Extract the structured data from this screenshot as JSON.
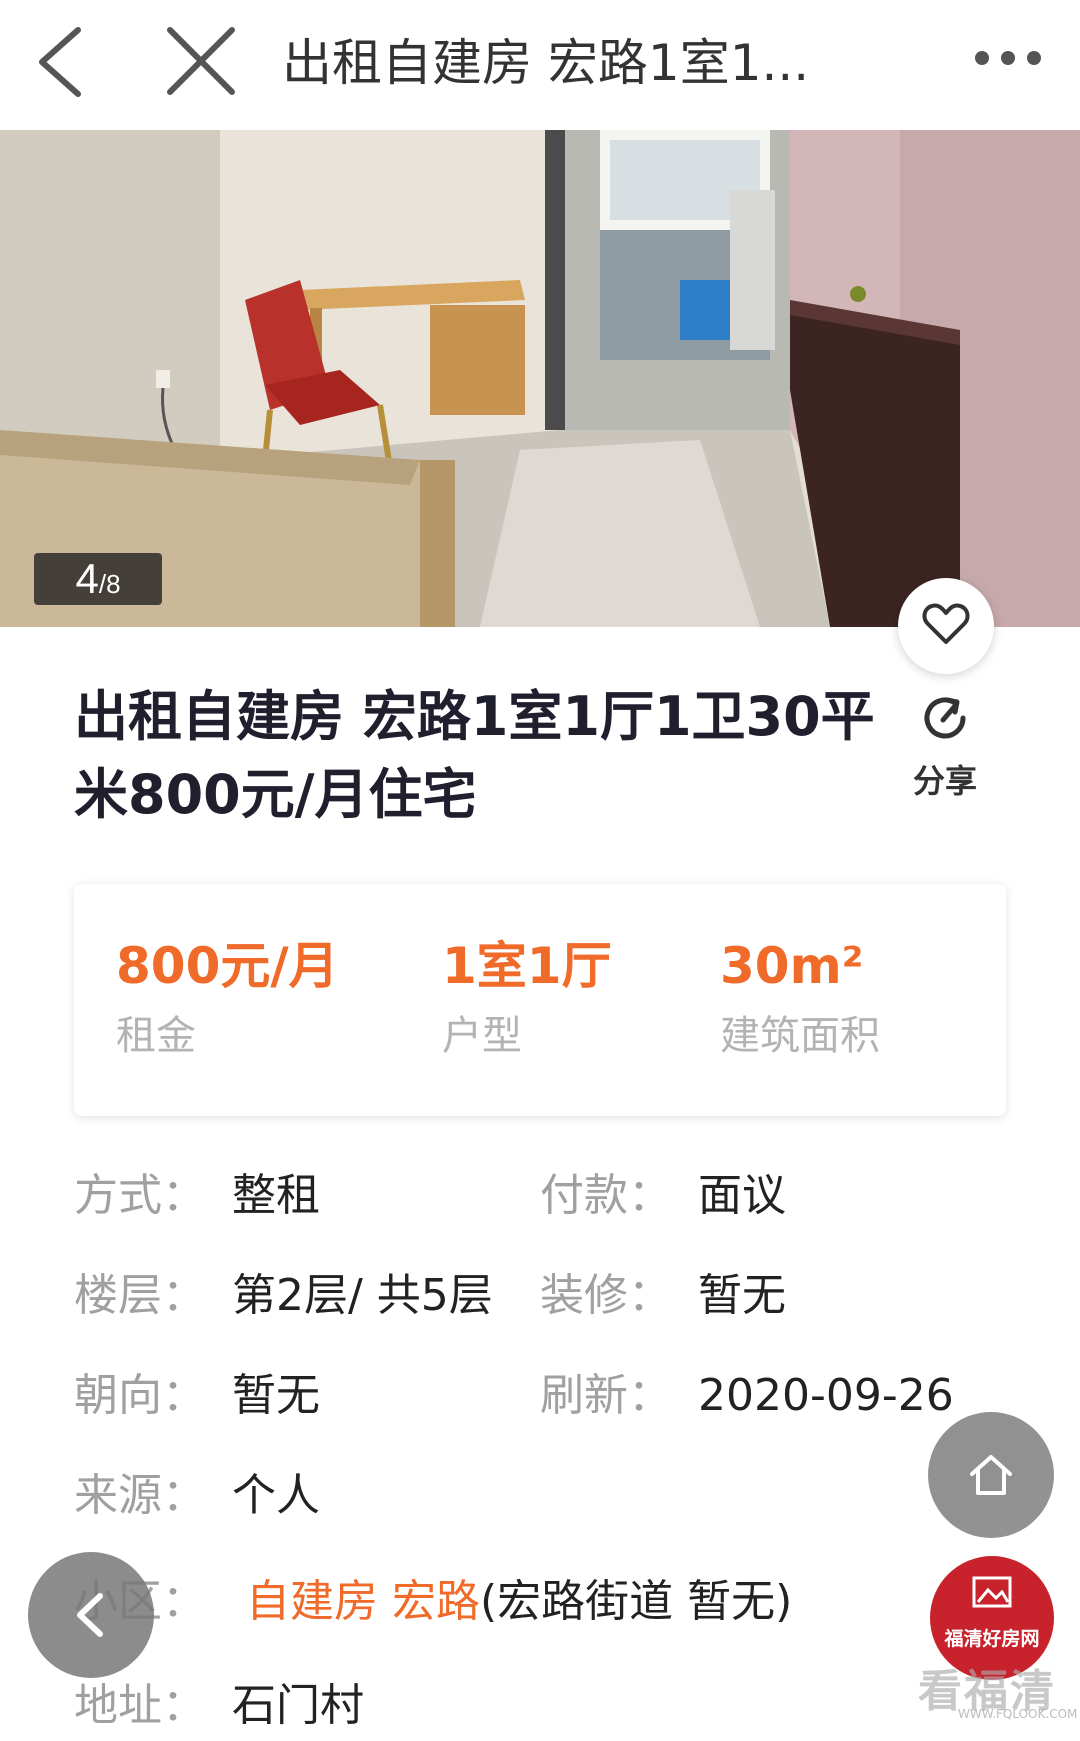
{
  "topbar": {
    "title": "出租自建房 宏路1室1...",
    "back_icon": "chevron-left-icon",
    "close_icon": "close-icon",
    "more_icon": "more-dots-icon"
  },
  "gallery": {
    "current": "4",
    "separator": "/",
    "total": "8"
  },
  "listing": {
    "title": "出租自建房 宏路1室1厅1卫30平米800元/月住宅",
    "share_label": "分享"
  },
  "stats": [
    {
      "value": "800元/月",
      "label": "租金"
    },
    {
      "value": "1室1厅",
      "label": "户型"
    },
    {
      "value": "30m²",
      "label": "建筑面积"
    }
  ],
  "details": {
    "mode": {
      "key": "方式：",
      "value": "整租"
    },
    "payment": {
      "key": "付款：",
      "value": "面议"
    },
    "floor": {
      "key": "楼层：",
      "value": "第2层/ 共5层"
    },
    "decoration": {
      "key": "装修：",
      "value": "暂无"
    },
    "orientation": {
      "key": "朝向：",
      "value": "暂无"
    },
    "refresh": {
      "key": "刷新：",
      "value": "2020-09-26"
    },
    "source": {
      "key": "来源：",
      "value": "个人"
    },
    "community": {
      "key": "小区：",
      "link": "自建房 宏路",
      "value": "(宏路街道 暂无)"
    },
    "address": {
      "key": "地址：",
      "value": "石门村"
    }
  },
  "watermark": {
    "seal_text": "福清好房网",
    "text": "看福清",
    "url": "WWW.FQLOOK.COM"
  },
  "colors": {
    "accent": "#f06a2a",
    "label_gray": "#a0a0a0",
    "watermark_red": "#c8232c"
  }
}
